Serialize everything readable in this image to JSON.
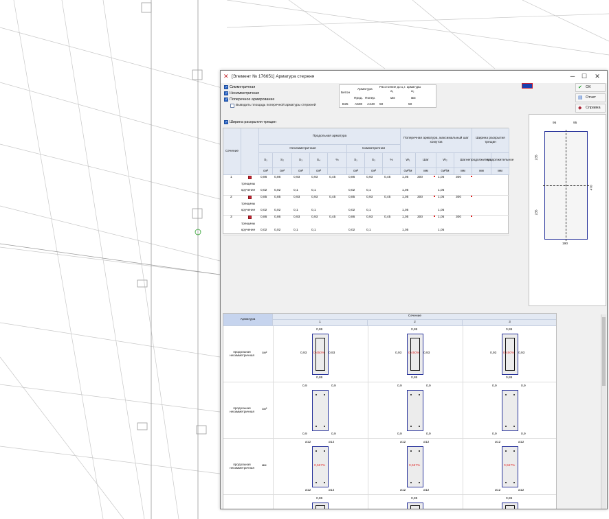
{
  "window": {
    "title": "[Элемент № 176651] Арматура стержня",
    "min": "─",
    "max": "☐",
    "close": "✕"
  },
  "buttons": {
    "ok": "ОК",
    "report": "Отчет",
    "help": "Справка"
  },
  "options": {
    "symmetric": "Симметричная",
    "asymmetric": "Несимметричная",
    "transverse": "Поперечное армирование",
    "output_transverse": "Выводить площадь поперечной арматуры стержней",
    "crack_width": "Ширина раскрытия трещин"
  },
  "params": {
    "beton_label": "Бетон",
    "armatura_label": "Арматура",
    "dist_label": "Расстояние до ц.т. арматуры",
    "prod": "Прод.",
    "poper": "Попер.",
    "a1": "a₁",
    "a2": "a₂",
    "mm1": "мм",
    "mm2": "мм",
    "beton": "B25",
    "arm_prod": "A500",
    "arm_poper": "A240",
    "a1_val": "50",
    "a2_val": "50"
  },
  "table": {
    "h_section": "Сечение",
    "h_long": "Продольная арматура",
    "h_asym": "Несимметричная",
    "h_sym": "Симметричная",
    "h_trans": "Поперечная арматура, максимальный шаг хомутов",
    "h_crack": "Ширина раскрытия трещин",
    "cols": [
      "S₁",
      "S₂",
      "S₃",
      "S₄",
      "%",
      "S₁",
      "S₃",
      "%",
      "W₁",
      "Шаг",
      "W₂",
      "Шаг",
      "непродолжительное",
      "продолжительное"
    ],
    "units": [
      "см²",
      "см²",
      "см²",
      "см²",
      "",
      "см²",
      "см²",
      "",
      "см²/м",
      "мм",
      "см²/м",
      "мм",
      "мм",
      "мм"
    ],
    "rows": [
      {
        "n": "1",
        "r1": [
          "0,86",
          "0,86",
          "0,93",
          "0,93",
          "0,45",
          "0,86",
          "0,93",
          "0,45",
          "1,05",
          "300",
          "1,05",
          "300"
        ],
        "lbl2": "трещины",
        "lbl3": "кручение",
        "r3": [
          "0,02",
          "0,02",
          "0,1",
          "0,1",
          "",
          "0,02",
          "0,1",
          "",
          "1,05",
          "",
          "1,05",
          ""
        ]
      },
      {
        "n": "2",
        "r1": [
          "0,85",
          "0,85",
          "0,93",
          "0,93",
          "0,45",
          "0,85",
          "0,93",
          "0,45",
          "1,05",
          "300",
          "1,05",
          "300"
        ],
        "lbl2": "трещины",
        "lbl3": "кручение",
        "r3": [
          "0,02",
          "0,02",
          "0,1",
          "0,1",
          "",
          "0,02",
          "0,1",
          "",
          "1,05",
          "",
          "1,05",
          ""
        ]
      },
      {
        "n": "3",
        "r1": [
          "0,86",
          "0,86",
          "0,93",
          "0,93",
          "0,45",
          "0,86",
          "0,93",
          "0,45",
          "1,05",
          "300",
          "1,05",
          "300"
        ],
        "lbl2": "трещины",
        "lbl3": "кручение",
        "r3": [
          "0,02",
          "0,02",
          "0,1",
          "0,1",
          "",
          "0,02",
          "0,1",
          "",
          "1,05",
          "",
          "1,05",
          ""
        ]
      }
    ]
  },
  "section_preview": {
    "w_left": "95",
    "w_right": "95",
    "h_top": "235",
    "h_bottom": "235",
    "h_total": "470",
    "width": "190"
  },
  "grid": {
    "h_arm": "Арматура",
    "h_section": "Сечение",
    "sections": [
      "1",
      "2",
      "3"
    ],
    "rows": [
      {
        "label": "продольная несимметричная",
        "unit": "см²"
      },
      {
        "label": "продольная несимметричная",
        "unit": "см²"
      },
      {
        "label": "продольная несимметричная",
        "unit": "мм"
      },
      {
        "label": "",
        "unit": ""
      }
    ],
    "r1": [
      {
        "top": "0,86",
        "bottom": "0,86",
        "left": "0,93",
        "right": "0,93",
        "pct": "0,450%"
      },
      {
        "top": "0,86",
        "bottom": "0,86",
        "left": "0,93",
        "right": "0,93",
        "pct": "0,450%"
      },
      {
        "top": "0,86",
        "bottom": "0,86",
        "left": "0,93",
        "right": "0,93",
        "pct": "0,450%"
      }
    ],
    "r2": [
      {
        "tl": "0,9",
        "tr": "0,9",
        "bl": "0,9",
        "br": "0,9"
      },
      {
        "tl": "0,9",
        "tr": "0,9",
        "bl": "0,9",
        "br": "0,9"
      },
      {
        "tl": "0,9",
        "tr": "0,9",
        "bl": "0,9",
        "br": "0,9"
      }
    ],
    "r3": [
      {
        "tl": "ø12",
        "tr": "ø12",
        "bl": "ø12",
        "br": "ø12",
        "pct": "0,567%"
      },
      {
        "tl": "ø12",
        "tr": "ø12",
        "bl": "ø12",
        "br": "ø12",
        "pct": "0,567%"
      },
      {
        "tl": "ø12",
        "tr": "ø12",
        "bl": "ø12",
        "br": "ø12",
        "pct": "0,567%"
      }
    ],
    "r4": [
      "0,86",
      "0,85",
      "0,86"
    ]
  },
  "colors": {
    "accent": "#2c66c7",
    "rebar": "#26319a",
    "highlight": "#e03030"
  }
}
